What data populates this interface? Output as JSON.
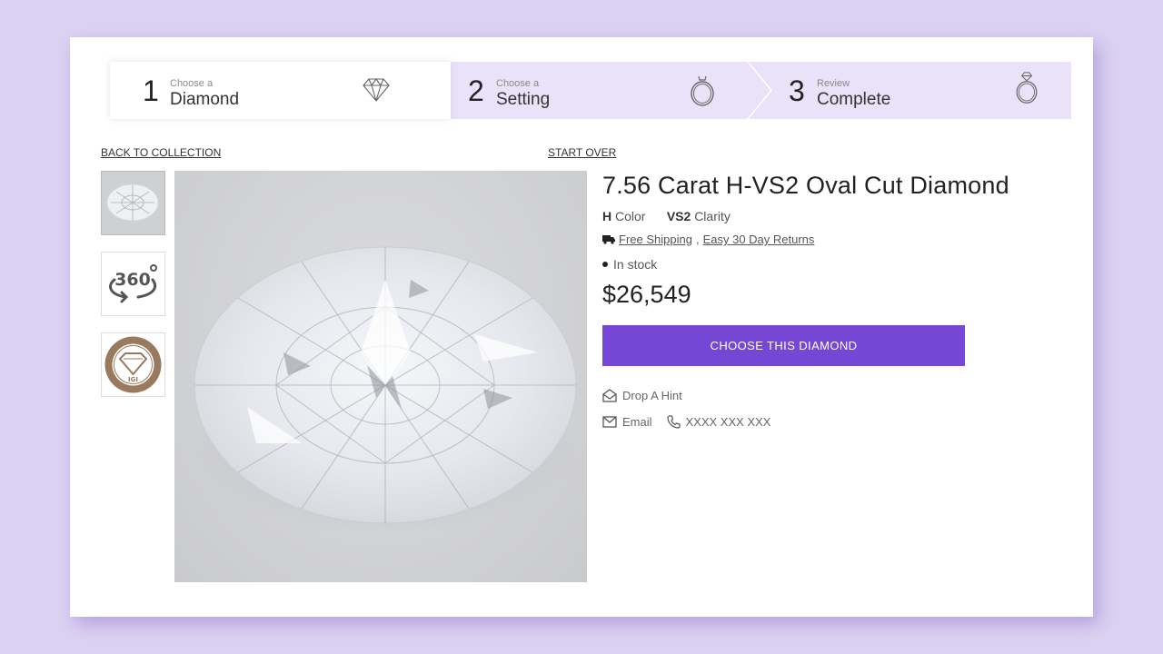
{
  "stepper": {
    "steps": [
      {
        "number": "1",
        "subtitle": "Choose a",
        "title": "Diamond",
        "icon": "diamond-icon",
        "state": "current"
      },
      {
        "number": "2",
        "subtitle": "Choose a",
        "title": "Setting",
        "icon": "ring-icon",
        "state": "upcoming"
      },
      {
        "number": "3",
        "subtitle": "Review",
        "title": "Complete",
        "icon": "ring-with-diamond-icon",
        "state": "upcoming"
      }
    ]
  },
  "nav": {
    "back_label": "BACK TO COLLECTION",
    "start_over_label": "START OVER"
  },
  "gallery": {
    "thumbnails": [
      {
        "type": "photo",
        "label": "Diamond photo"
      },
      {
        "type": "360-view",
        "label": "360"
      },
      {
        "type": "certificate",
        "label": "IGI certificate"
      }
    ]
  },
  "product": {
    "title": "7.56 Carat H-VS2 Oval Cut Diamond",
    "color_value": "H",
    "color_label": "Color",
    "clarity_value": "VS2",
    "clarity_label": "Clarity",
    "shipping_label": "Free Shipping",
    "returns_label": "Easy 30 Day Returns",
    "stock_status": "In stock",
    "price": "$26,549",
    "cta_label": "CHOOSE THIS DIAMOND",
    "hint_label": "Drop A Hint",
    "email_label": "Email",
    "phone_label": "XXXX XXX XXX"
  },
  "colors": {
    "accent": "#7646d5",
    "step_bg": "#e9e2f8",
    "page_bg": "#dcd2f1"
  }
}
